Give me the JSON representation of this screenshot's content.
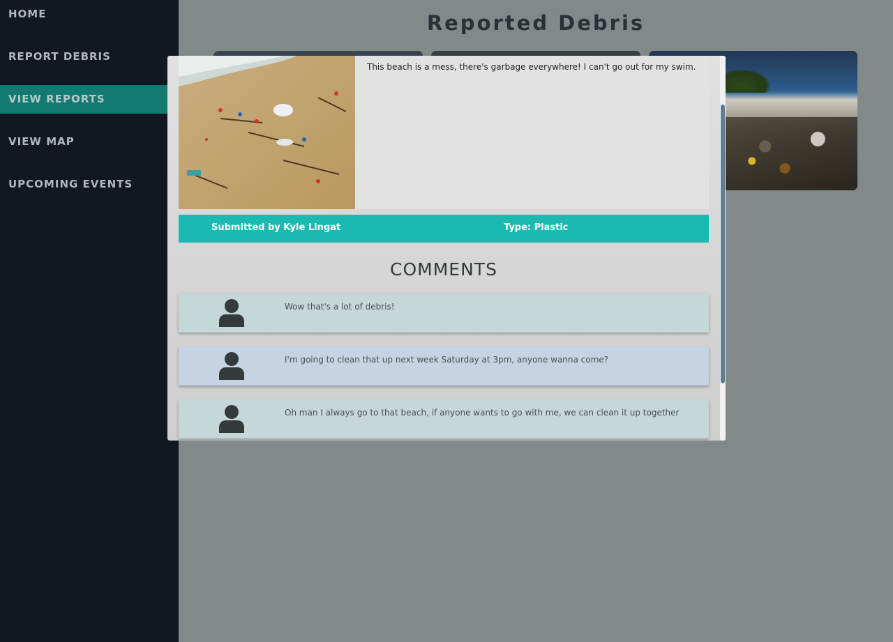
{
  "sidebar": {
    "items": [
      {
        "label": "HOME"
      },
      {
        "label": "REPORT DEBRIS"
      },
      {
        "label": "VIEW REPORTS"
      },
      {
        "label": "VIEW MAP"
      },
      {
        "label": "UPCOMING EVENTS"
      }
    ],
    "active_item": "VIEW REPORTS"
  },
  "main": {
    "title": "Reported Debris"
  },
  "modal": {
    "description": "This beach is a mess, there's garbage everywhere! I can't go out for my swim.",
    "submitted_by": "Submitted by Kyle Lingat",
    "type": "Type: Plastic",
    "comments_heading": "COMMENTS",
    "comments": [
      {
        "text": "Wow that's a lot of debris!",
        "background": "#c5d7d7"
      },
      {
        "text": "I'm going to clean that up next week Saturday at 3pm, anyone wanna come?",
        "background": "#c5d3e3"
      },
      {
        "text": "Oh man I always go to that beach, if anyone wants to go with me, we can clean it up together",
        "background": "#c5d7d7"
      }
    ]
  },
  "colors": {
    "sidebar_bg": "#111822",
    "active_nav_bg": "#127a72",
    "info_bar_bg": "#1abab3",
    "page_bg": "#818989"
  }
}
